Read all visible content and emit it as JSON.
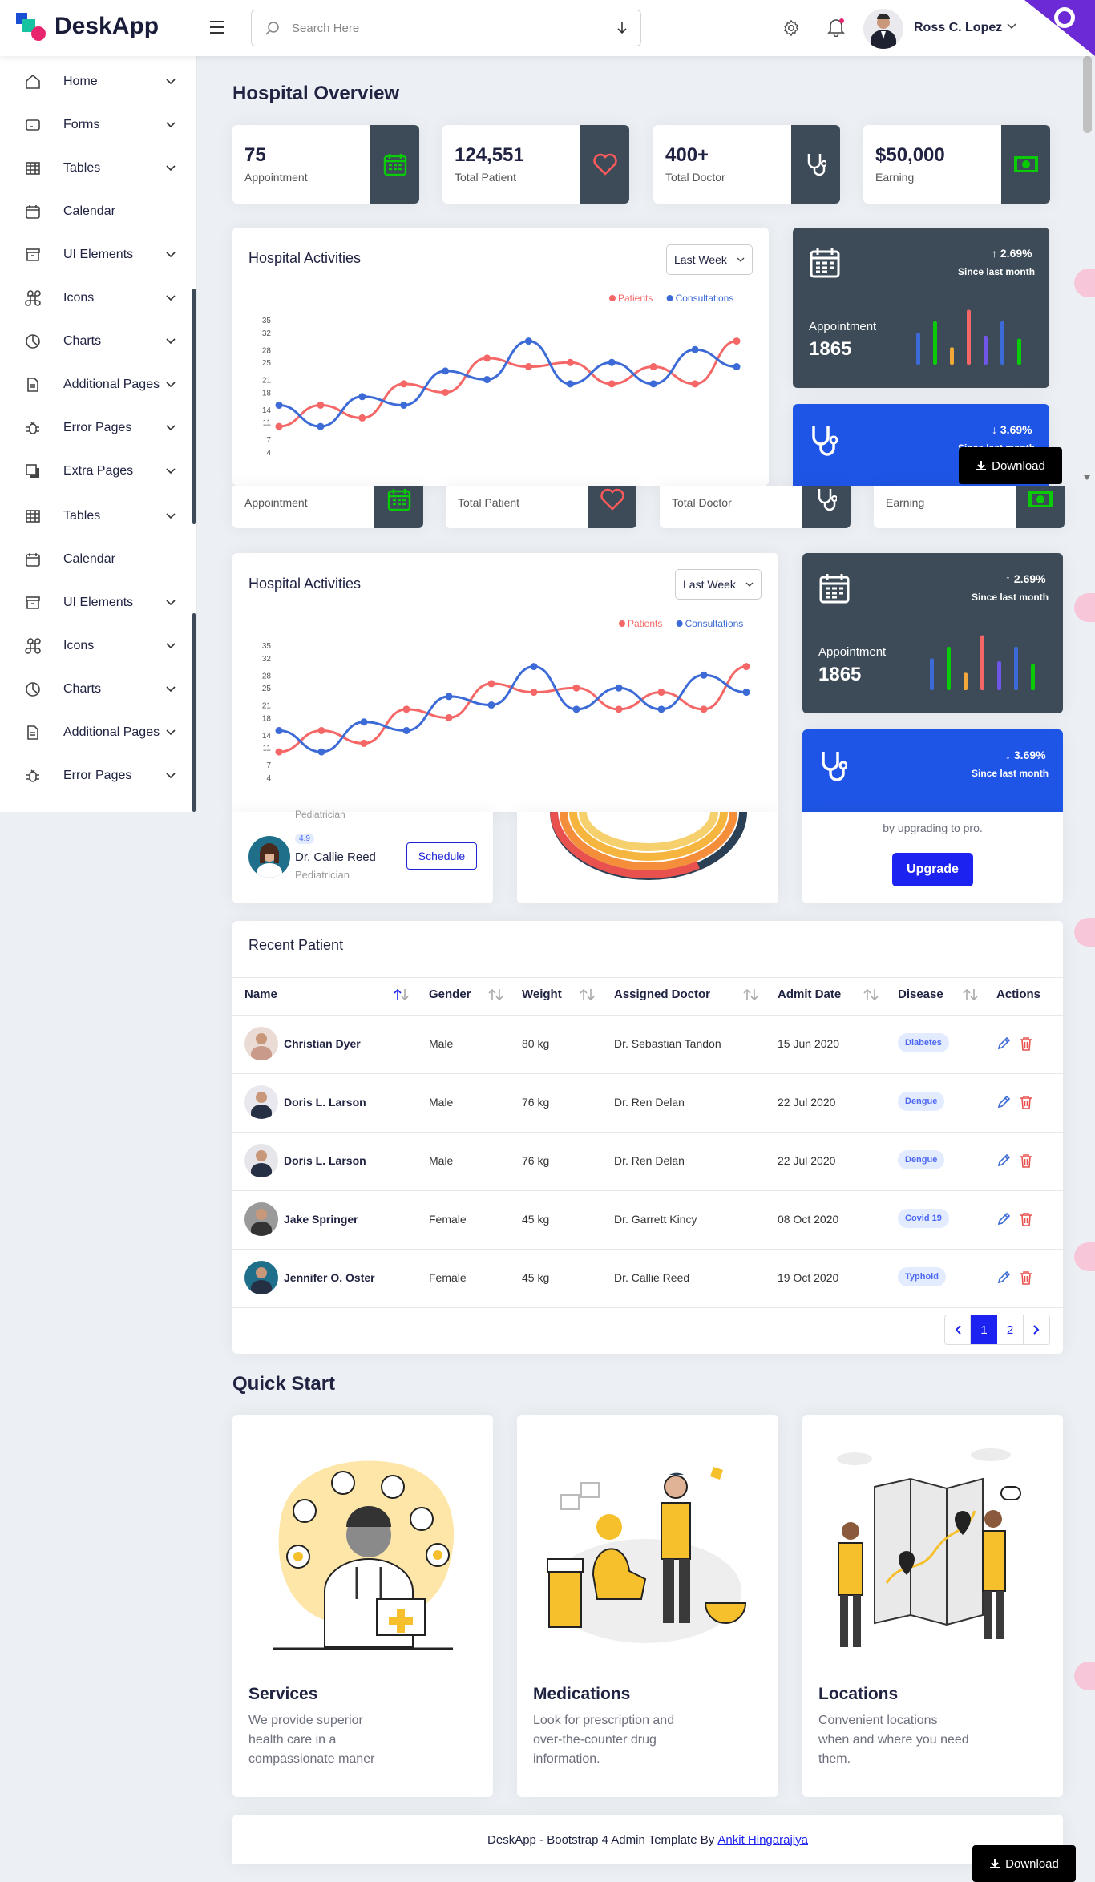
{
  "brand": {
    "name": "DeskApp"
  },
  "search": {
    "placeholder": "Search Here"
  },
  "user": {
    "name": "Ross C. Lopez"
  },
  "sidebar": {
    "items": [
      {
        "label": "Home",
        "icon": "home-icon"
      },
      {
        "label": "Forms",
        "icon": "forms-icon"
      },
      {
        "label": "Tables",
        "icon": "table-icon"
      },
      {
        "label": "Calendar",
        "icon": "calendar-icon"
      },
      {
        "label": "UI Elements",
        "icon": "archive-icon"
      },
      {
        "label": "Icons",
        "icon": "command-icon"
      },
      {
        "label": "Charts",
        "icon": "pie-chart-icon"
      },
      {
        "label": "Additional Pages",
        "icon": "file-icon"
      },
      {
        "label": "Error Pages",
        "icon": "bug-icon"
      },
      {
        "label": "Extra Pages",
        "icon": "copy-icon"
      }
    ],
    "items_repeat": [
      {
        "label": "Tables",
        "icon": "table-icon"
      },
      {
        "label": "Calendar",
        "icon": "calendar-icon"
      },
      {
        "label": "UI Elements",
        "icon": "archive-icon"
      },
      {
        "label": "Icons",
        "icon": "command-icon"
      },
      {
        "label": "Charts",
        "icon": "pie-chart-icon"
      },
      {
        "label": "Additional Pages",
        "icon": "file-icon"
      },
      {
        "label": "Error Pages",
        "icon": "bug-icon"
      },
      {
        "label": "Extra Pages",
        "icon": "copy-icon"
      }
    ]
  },
  "page": {
    "title": "Hospital Overview"
  },
  "stats": [
    {
      "value": "75",
      "label": "Appointment",
      "icon": "calendar-icon",
      "color": "#09cc06"
    },
    {
      "value": "124,551",
      "label": "Total Patient",
      "icon": "heart-icon",
      "color": "#ff5b5b"
    },
    {
      "value": "400+",
      "label": "Total Doctor",
      "icon": "stethoscope-icon",
      "color": "#ffffff"
    },
    {
      "value": "$50,000",
      "label": "Earning",
      "icon": "money-icon",
      "color": "#09cc06"
    }
  ],
  "stats_repeat": [
    {
      "value": "75",
      "label": "Appointment"
    },
    {
      "value": "124,551",
      "label": "Total Patient"
    },
    {
      "value": "400+",
      "label": "Total Doctor"
    },
    {
      "value": "$50,000",
      "label": "Earning"
    }
  ],
  "activities": {
    "title": "Hospital Activities",
    "filter": "Last Week"
  },
  "chart_data": {
    "type": "line",
    "title": "Hospital Activities",
    "x": [
      1,
      2,
      3,
      4,
      5,
      6,
      7,
      8,
      9,
      10,
      11,
      12
    ],
    "series": [
      {
        "name": "Patients",
        "color": "#f56767",
        "values": [
          10,
          15,
          12,
          20,
          18,
          26,
          24,
          25,
          20,
          24,
          20,
          30
        ]
      },
      {
        "name": "Consultations",
        "color": "#3c6ad6",
        "values": [
          15,
          10,
          17,
          15,
          23,
          21,
          30,
          20,
          25,
          20,
          28,
          24
        ]
      }
    ],
    "yticks": [
      4,
      7,
      11,
      14,
      18,
      21,
      25,
      28,
      32,
      35
    ],
    "ylim": [
      4,
      35
    ],
    "legend": "top-right",
    "grid": false
  },
  "summary_cards": [
    {
      "label": "Appointment",
      "value": "1865",
      "change": "2.69%",
      "since": "Since last month",
      "direction": "up",
      "bg": "#3c4b57",
      "bars": [
        {
          "h": 0.55,
          "color": "#3c6ad6"
        },
        {
          "h": 0.75,
          "color": "#09cc06"
        },
        {
          "h": 0.3,
          "color": "#f4a73b"
        },
        {
          "h": 0.95,
          "color": "#f56767"
        },
        {
          "h": 0.5,
          "color": "#6f56e8"
        },
        {
          "h": 0.75,
          "color": "#3c6ad6"
        },
        {
          "h": 0.45,
          "color": "#09cc06"
        }
      ]
    },
    {
      "label": "",
      "value": "",
      "change": "3.69%",
      "since": "Since last month",
      "direction": "down",
      "bg": "#1f55e6"
    }
  ],
  "download": {
    "label": "Download"
  },
  "doctor": {
    "name": "Dr. Callie Reed",
    "specialty": "Pediatrician",
    "rating": "4.9",
    "button": "Schedule",
    "specialty_top": "Pediatrician"
  },
  "upgrade": {
    "text": "by upgrading to pro.",
    "button": "Upgrade"
  },
  "recent": {
    "title": "Recent Patient",
    "columns": [
      "Name",
      "Gender",
      "Weight",
      "Assigned Doctor",
      "Admit Date",
      "Disease",
      "Actions"
    ],
    "rows": [
      {
        "name": "Christian Dyer",
        "gender": "Male",
        "weight": "80 kg",
        "doctor": "Dr. Sebastian Tandon",
        "date": "15 Jun 2020",
        "disease": "Diabetes"
      },
      {
        "name": "Doris L. Larson",
        "gender": "Male",
        "weight": "76 kg",
        "doctor": "Dr. Ren Delan",
        "date": "22 Jul 2020",
        "disease": "Dengue"
      },
      {
        "name": "Doris L. Larson",
        "gender": "Male",
        "weight": "76 kg",
        "doctor": "Dr. Ren Delan",
        "date": "22 Jul 2020",
        "disease": "Dengue"
      },
      {
        "name": "Jake Springer",
        "gender": "Female",
        "weight": "45 kg",
        "doctor": "Dr. Garrett Kincy",
        "date": "08 Oct 2020",
        "disease": "Covid 19"
      },
      {
        "name": "Jennifer O. Oster",
        "gender": "Female",
        "weight": "45 kg",
        "doctor": "Dr. Callie Reed",
        "date": "19 Oct 2020",
        "disease": "Typhoid"
      }
    ],
    "pages": [
      "1",
      "2"
    ],
    "current_page": "1"
  },
  "quick_start": {
    "title": "Quick Start",
    "cards": [
      {
        "title": "Services",
        "text": "We provide superior health care in a compassionate maner"
      },
      {
        "title": "Medications",
        "text": "Look for prescription and over-the-counter drug information."
      },
      {
        "title": "Locations",
        "text": "Convenient locations when and where you need them."
      }
    ]
  },
  "footer": {
    "text": "DeskApp - Bootstrap 4 Admin Template By ",
    "link": "Ankit Hingarajiya"
  }
}
